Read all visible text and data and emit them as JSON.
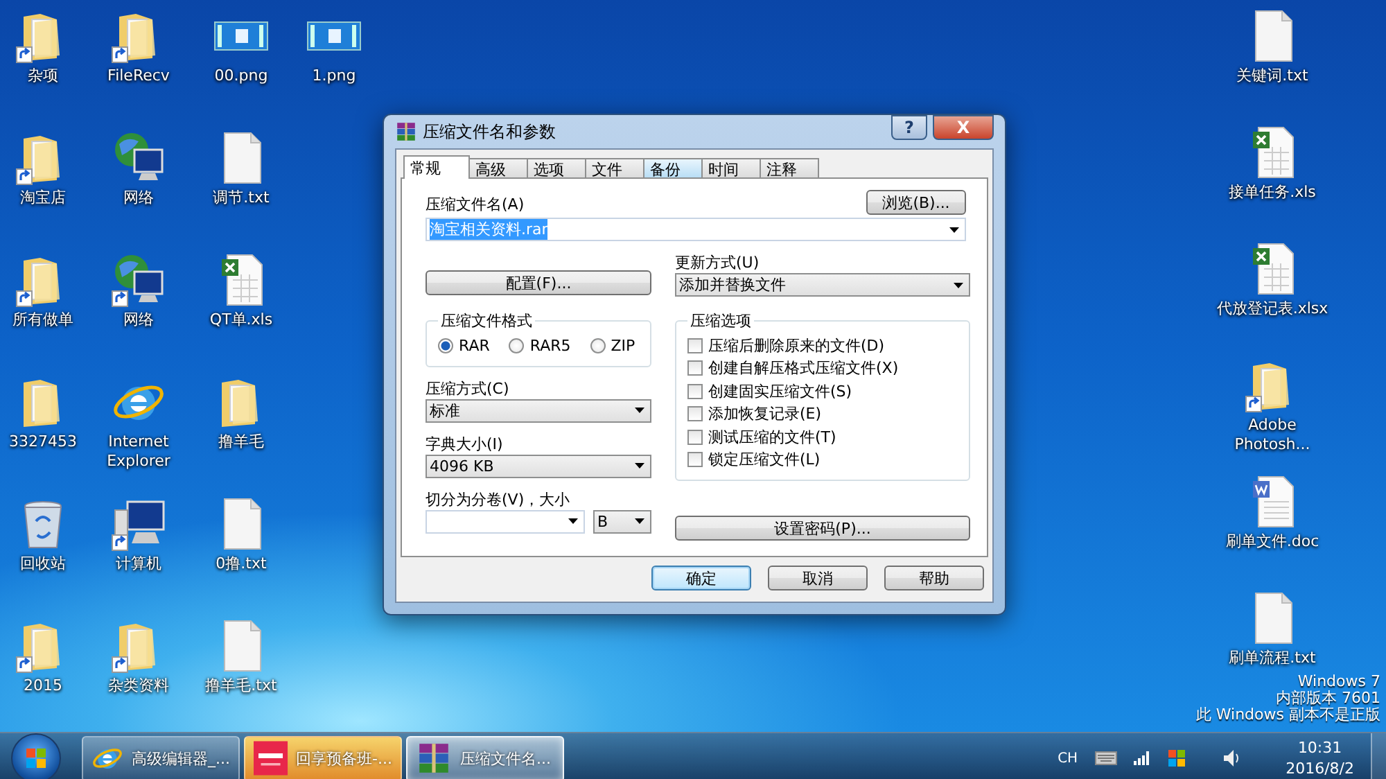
{
  "desktop": {
    "left_columns": [
      [
        {
          "label": "杂项",
          "kind": "folder",
          "shortcut": true
        },
        {
          "label": "淘宝店",
          "kind": "folder",
          "shortcut": true
        },
        {
          "label": "所有做单",
          "kind": "folder",
          "shortcut": true
        },
        {
          "label": "3327453",
          "kind": "folder",
          "shortcut": false
        },
        {
          "label": "回收站",
          "kind": "recycle-bin",
          "shortcut": false
        },
        {
          "label": "2015",
          "kind": "folder",
          "shortcut": true
        }
      ],
      [
        {
          "label": "FileRecv",
          "kind": "folder",
          "shortcut": true
        },
        {
          "label": "网络",
          "kind": "network",
          "shortcut": false
        },
        {
          "label": "网络",
          "kind": "network",
          "shortcut": true
        },
        {
          "label": "Internet Explorer",
          "kind": "browser",
          "shortcut": false
        },
        {
          "label": "计算机",
          "kind": "computer",
          "shortcut": true
        },
        {
          "label": "杂类资料",
          "kind": "folder",
          "shortcut": true
        }
      ],
      [
        {
          "label": "00.png",
          "kind": "image",
          "shortcut": false
        },
        {
          "label": "调节.txt",
          "kind": "text",
          "shortcut": false
        },
        {
          "label": "QT单.xls",
          "kind": "excel",
          "shortcut": false
        },
        {
          "label": "撸羊毛",
          "kind": "folder",
          "shortcut": false
        },
        {
          "label": "0撸.txt",
          "kind": "text",
          "shortcut": false
        },
        {
          "label": "撸羊毛.txt",
          "kind": "text",
          "shortcut": false
        }
      ],
      [
        {
          "label": "1.png",
          "kind": "image",
          "shortcut": false
        }
      ]
    ],
    "right_column": [
      {
        "label": "关键词.txt",
        "kind": "text",
        "shortcut": false
      },
      {
        "label": "接单任务.xls",
        "kind": "excel",
        "shortcut": false
      },
      {
        "label": "代放登记表.xlsx",
        "kind": "excel",
        "shortcut": false
      },
      {
        "label": "Adobe Photosh...",
        "kind": "folder",
        "shortcut": true
      },
      {
        "label": "刷单文件.doc",
        "kind": "word",
        "shortcut": false
      },
      {
        "label": "刷单流程.txt",
        "kind": "text",
        "shortcut": false
      }
    ],
    "activation_notice": [
      "Windows 7",
      "内部版本 7601",
      "此 Windows 副本不是正版"
    ]
  },
  "dialog": {
    "title": "压缩文件名和参数",
    "help_button": "?",
    "close_button": "X",
    "tabs": [
      {
        "label": "常规",
        "selected": true,
        "hover": false
      },
      {
        "label": "高级",
        "selected": false,
        "hover": false
      },
      {
        "label": "选项",
        "selected": false,
        "hover": false
      },
      {
        "label": "文件",
        "selected": false,
        "hover": false
      },
      {
        "label": "备份",
        "selected": false,
        "hover": true
      },
      {
        "label": "时间",
        "selected": false,
        "hover": false
      },
      {
        "label": "注释",
        "selected": false,
        "hover": false
      }
    ],
    "archive_name": {
      "label": "压缩文件名(A)",
      "browse_button": "浏览(B)...",
      "value": "淘宝相关资料.rar",
      "text_selected": true
    },
    "profiles_button": "配置(F)...",
    "update_mode": {
      "label": "更新方式(U)",
      "value": "添加并替换文件"
    },
    "archive_format": {
      "title": "压缩文件格式",
      "options": [
        {
          "label": "RAR",
          "selected": true
        },
        {
          "label": "RAR5",
          "selected": false
        },
        {
          "label": "ZIP",
          "selected": false
        }
      ]
    },
    "compression_method": {
      "label": "压缩方式(C)",
      "value": "标准"
    },
    "dictionary_size": {
      "label": "字典大小(I)",
      "value": "4096 KB"
    },
    "split_volumes": {
      "label": "切分为分卷(V)，大小",
      "unit": "B"
    },
    "archiving_options": {
      "title": "压缩选项",
      "options": [
        {
          "label": "压缩后删除原来的文件(D)",
          "checked": false
        },
        {
          "label": "创建自解压格式压缩文件(X)",
          "checked": false
        },
        {
          "label": "创建固实压缩文件(S)",
          "checked": false
        },
        {
          "label": "添加恢复记录(E)",
          "checked": false
        },
        {
          "label": "测试压缩的文件(T)",
          "checked": false
        },
        {
          "label": "锁定压缩文件(L)",
          "checked": false
        }
      ]
    },
    "password_button": "设置密码(P)...",
    "footer_buttons": [
      {
        "label": "确定",
        "default": true
      },
      {
        "label": "取消",
        "default": false
      },
      {
        "label": "帮助",
        "default": false
      }
    ]
  },
  "taskbar": {
    "tasks": [
      {
        "label": "高级编辑器_...",
        "kind": "browser",
        "selected": false,
        "flashing": false
      },
      {
        "label": "回享预备班-...",
        "kind": "app",
        "selected": false,
        "flashing": true
      },
      {
        "label": "压缩文件名...",
        "kind": "archiver",
        "selected": true,
        "flashing": false
      }
    ],
    "language": "CH",
    "time": "10:31",
    "date": "2016/8/2"
  }
}
